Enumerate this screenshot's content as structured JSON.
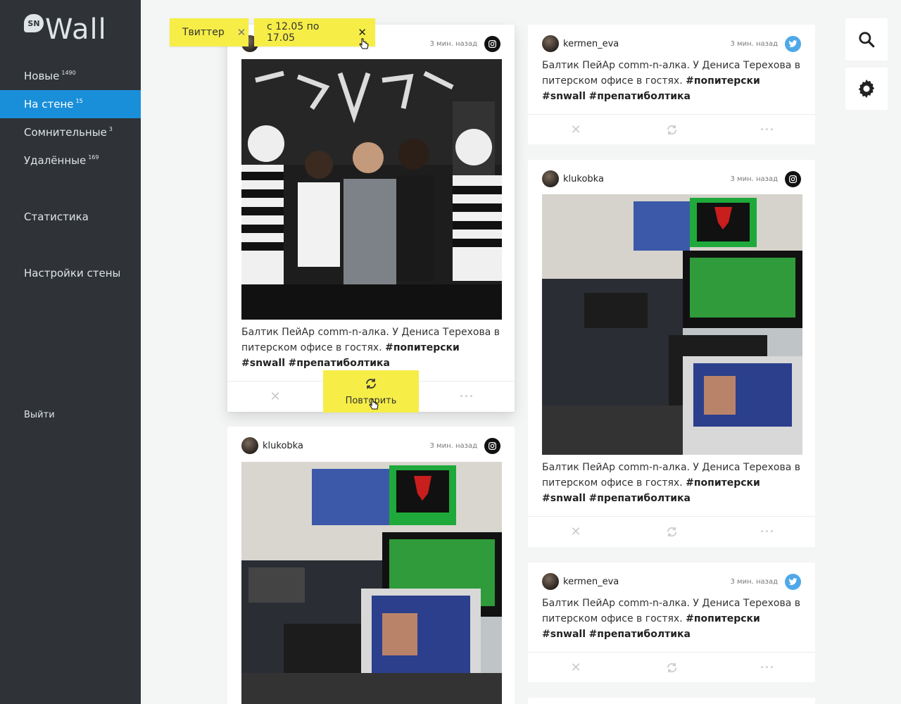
{
  "sidebar": {
    "logo_badge": "SN",
    "logo_word": "Wall",
    "items": [
      {
        "label": "Новые",
        "count": "1490"
      },
      {
        "label": "На стене",
        "count": "15"
      },
      {
        "label": "Сомнительные",
        "count": "3"
      },
      {
        "label": "Удалённые",
        "count": "169"
      }
    ],
    "stats": "Статистика",
    "wall_settings": "Настройки стены",
    "logout": "Выйти"
  },
  "filters": [
    {
      "label": "Твиттер",
      "close": "✕"
    },
    {
      "label": "с 12.05 по 17.05",
      "close": "✕"
    }
  ],
  "post_text": {
    "plain": "Балтик ПейАр comm-n-алка. У Дениса Терехова в питерском офисе в гостях. ",
    "tag1": "#попитерски",
    "tag2": "#snwall",
    "tag3": "#препатиболтика"
  },
  "posts": [
    {
      "username": "",
      "time": "3 мин. назад",
      "network": "instagram-icon"
    },
    {
      "username": "klukobka",
      "time": "3 мин. назад",
      "network": "instagram-icon"
    },
    {
      "username": "kermen_eva",
      "time": "3 мин. назад",
      "network": "twitter-icon"
    },
    {
      "username": "klukobka",
      "time": "3 мин. назад",
      "network": "instagram-icon"
    },
    {
      "username": "kermen_eva",
      "time": "3 мин. назад",
      "network": "twitter-icon"
    }
  ],
  "actions": {
    "remove": "✕",
    "more": "•••",
    "repeat_label": "Повторить"
  },
  "tools": {
    "search": "search-icon",
    "settings": "gear-icon"
  },
  "colors": {
    "sidebar": "#2f3337",
    "active": "#1a8fd9",
    "chip": "#f6ee47",
    "twitter": "#4fa8e8"
  }
}
